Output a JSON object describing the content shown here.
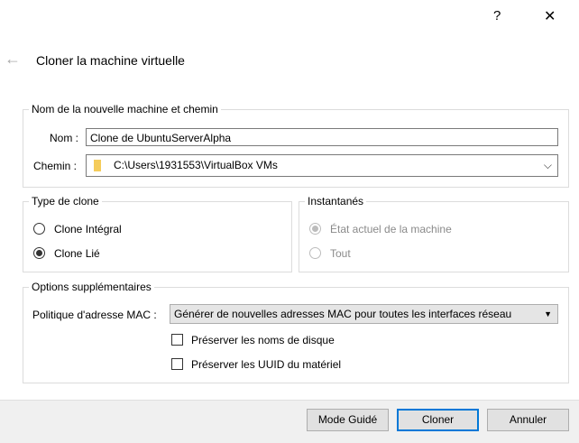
{
  "titlebar": {
    "help": "?",
    "close": "✕"
  },
  "header": {
    "title": "Cloner la machine virtuelle",
    "back": "←"
  },
  "name_group": {
    "legend": "Nom de la nouvelle machine et chemin",
    "name_label": "Nom :",
    "name_value": "Clone de UbuntuServerAlpha",
    "path_label": "Chemin :",
    "path_value": "C:\\Users\\1931553\\VirtualBox VMs"
  },
  "clone_type": {
    "legend": "Type de clone",
    "options": [
      {
        "label": "Clone Intégral",
        "selected": false
      },
      {
        "label": "Clone Lié",
        "selected": true
      }
    ]
  },
  "snapshots": {
    "legend": "Instantanés",
    "options": [
      {
        "label": "État actuel de la machine",
        "selected": true,
        "disabled": true
      },
      {
        "label": "Tout",
        "selected": false,
        "disabled": true
      }
    ]
  },
  "options": {
    "legend": "Options supplémentaires",
    "mac_label": "Politique d'adresse MAC :",
    "mac_value": "Générer de nouvelles adresses MAC pour toutes les interfaces réseau",
    "keep_disk_names": {
      "label": "Préserver les noms de disque",
      "checked": false
    },
    "keep_uuids": {
      "label": "Préserver les UUID du matériel",
      "checked": false
    }
  },
  "footer": {
    "guided": "Mode Guidé",
    "clone": "Cloner",
    "cancel": "Annuler"
  },
  "colors": {
    "accent": "#0078d7",
    "footer_bg": "#f0f0f0"
  }
}
